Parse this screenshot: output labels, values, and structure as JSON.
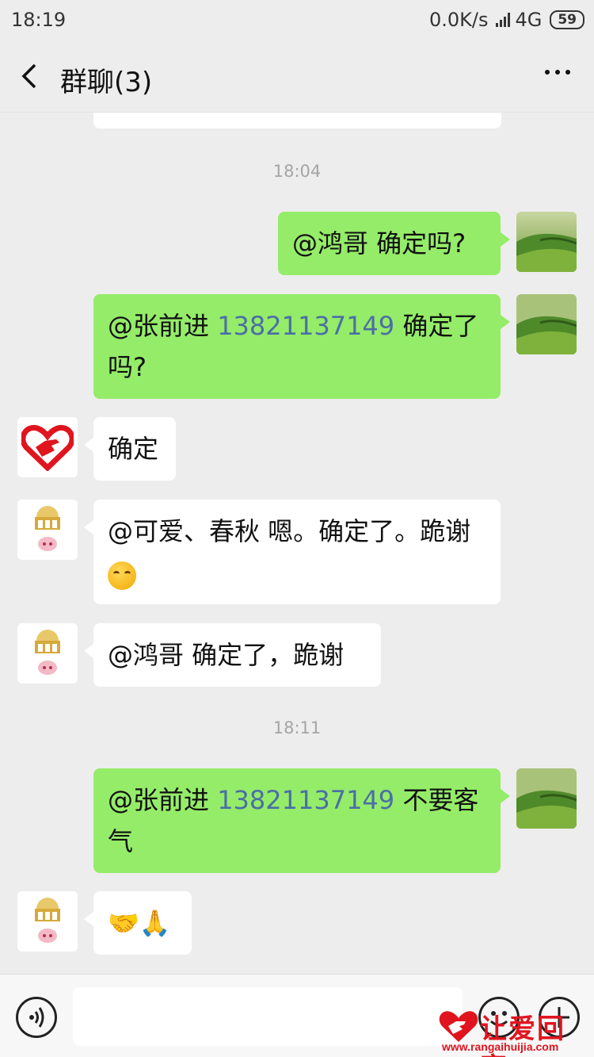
{
  "status_bar": {
    "time": "18:19",
    "network_speed": "0.0K/s",
    "network_type": "4G",
    "battery": "59"
  },
  "header": {
    "title": "群聊(3)"
  },
  "timestamps": [
    "18:04",
    "18:11"
  ],
  "messages": [
    {
      "side": "right",
      "parts": [
        {
          "text": "@鸿哥  确定吗?"
        }
      ]
    },
    {
      "side": "right",
      "parts": [
        {
          "text": "@张前进 "
        },
        {
          "text": "13821137149",
          "phone": true
        },
        {
          "text": "  确定了吗?"
        }
      ]
    },
    {
      "side": "left",
      "avatar": "heart-hand-logo",
      "parts": [
        {
          "text": "确定"
        }
      ]
    },
    {
      "side": "left",
      "avatar": "shop-logo",
      "parts": [
        {
          "text": "@可爱、春秋  嗯。确定了。跪谢"
        }
      ],
      "emoji": "smiling-face-emoji"
    },
    {
      "side": "left",
      "avatar": "shop-logo",
      "parts": [
        {
          "text": "@鸿哥  确定了，跪谢"
        }
      ]
    },
    {
      "side": "right",
      "parts": [
        {
          "text": "@张前进 "
        },
        {
          "text": "13821137149",
          "phone": true
        },
        {
          "text": "  不要客气"
        }
      ]
    },
    {
      "side": "left",
      "avatar": "shop-logo",
      "parts": [
        {
          "text": "🤝🙏"
        }
      ]
    }
  ],
  "input": {
    "value": "",
    "placeholder": ""
  },
  "icons": {
    "back": "back-chevron-icon",
    "more": "more-dots-icon",
    "voice": "voice-icon",
    "emoji": "emoji-icon",
    "plus": "plus-icon"
  },
  "watermark": {
    "text": "让爱回家",
    "url": "www.rangaihuijia.com"
  },
  "colors": {
    "background": "#ededed",
    "bubble_self": "#95ec69",
    "bubble_other": "#ffffff",
    "phone_link": "#4a6fa5",
    "watermark": "#e0141e"
  }
}
